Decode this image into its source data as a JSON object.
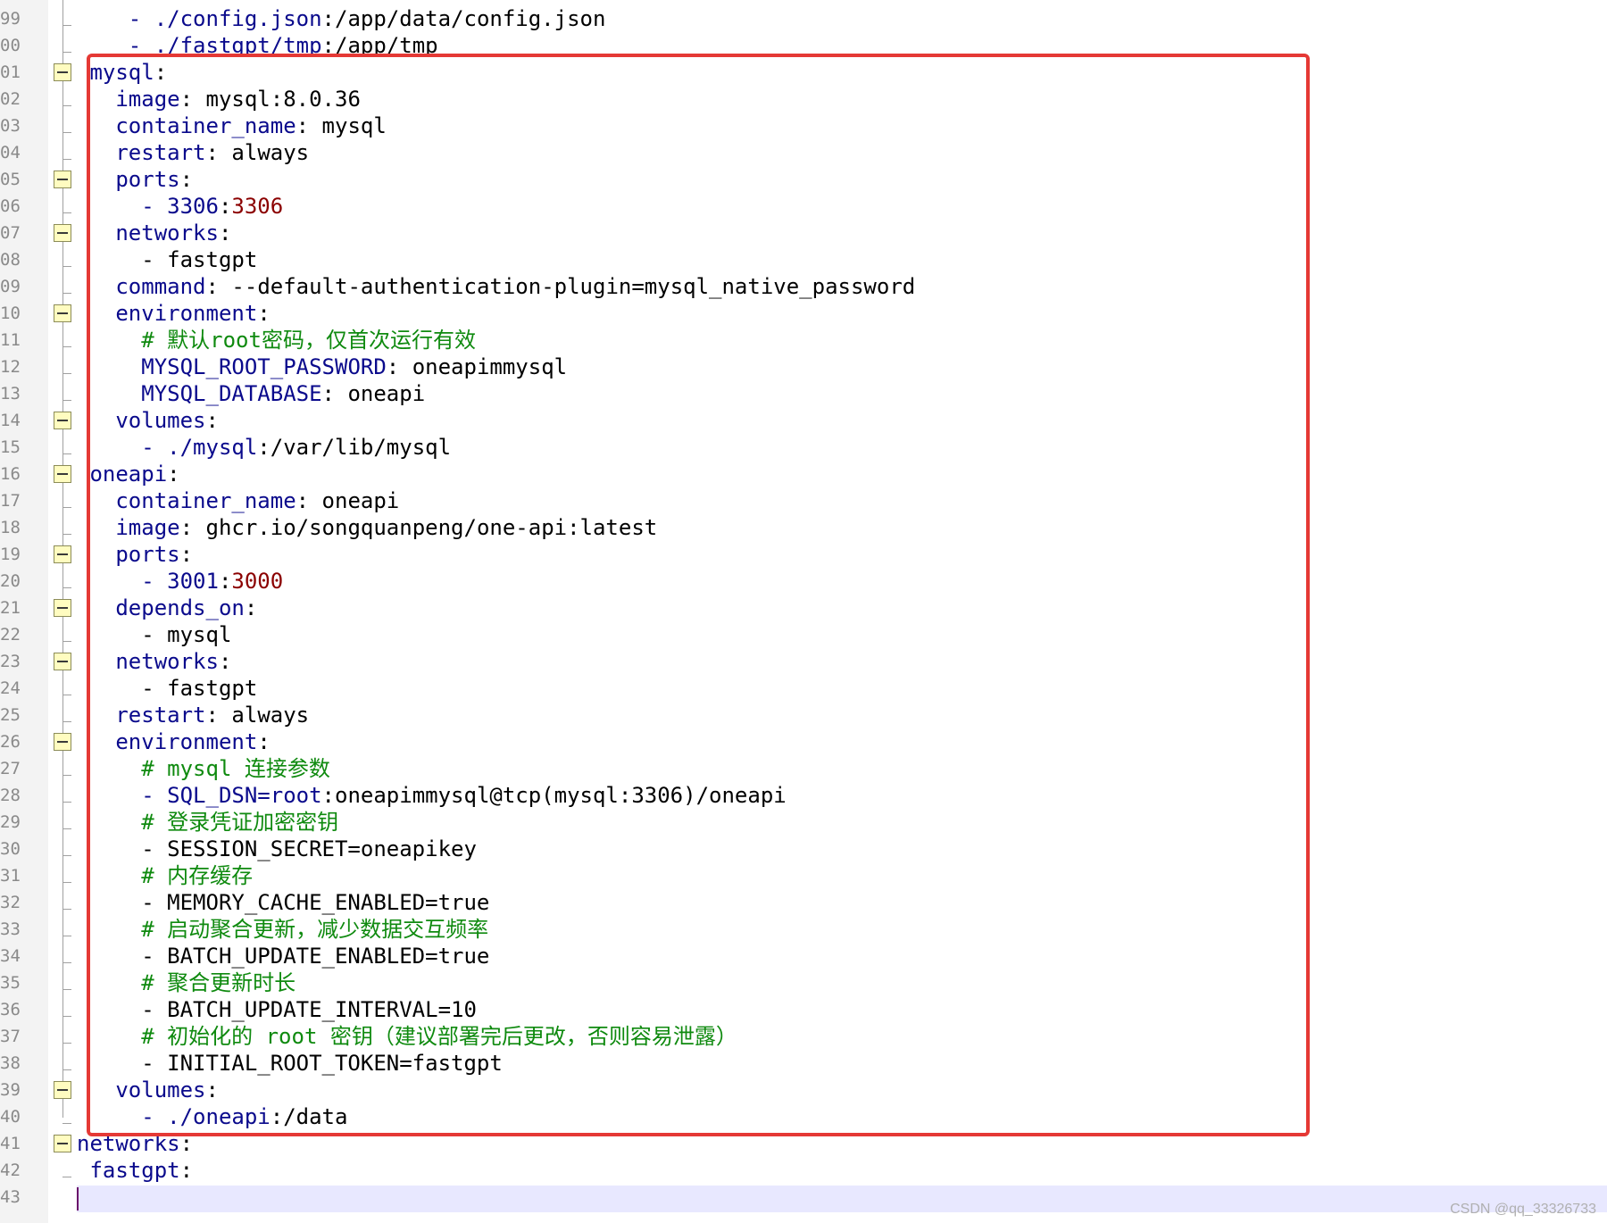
{
  "editor": {
    "lines": [
      {
        "num": "99",
        "fold": false,
        "segments": [
          {
            "t": "    ",
            "c": "v"
          },
          {
            "t": "- ./config.json",
            "c": "k"
          },
          {
            "t": ":/app/data/config.json",
            "c": "v"
          }
        ]
      },
      {
        "num": "00",
        "fold": false,
        "segments": [
          {
            "t": "    ",
            "c": "v"
          },
          {
            "t": "- ./fastgpt/tmp",
            "c": "k"
          },
          {
            "t": ":/app/tmp",
            "c": "v"
          }
        ]
      },
      {
        "num": "01",
        "fold": true,
        "segments": [
          {
            "t": " ",
            "c": "v"
          },
          {
            "t": "mysql",
            "c": "k"
          },
          {
            "t": ":",
            "c": "v"
          }
        ]
      },
      {
        "num": "02",
        "fold": false,
        "segments": [
          {
            "t": "   ",
            "c": "v"
          },
          {
            "t": "image",
            "c": "k"
          },
          {
            "t": ": mysql:8.0.36",
            "c": "v"
          }
        ]
      },
      {
        "num": "03",
        "fold": false,
        "segments": [
          {
            "t": "   ",
            "c": "v"
          },
          {
            "t": "container_name",
            "c": "k"
          },
          {
            "t": ": mysql",
            "c": "v"
          }
        ]
      },
      {
        "num": "04",
        "fold": false,
        "segments": [
          {
            "t": "   ",
            "c": "v"
          },
          {
            "t": "restart",
            "c": "k"
          },
          {
            "t": ": always",
            "c": "v"
          }
        ]
      },
      {
        "num": "05",
        "fold": true,
        "segments": [
          {
            "t": "   ",
            "c": "v"
          },
          {
            "t": "ports",
            "c": "k"
          },
          {
            "t": ":",
            "c": "v"
          }
        ]
      },
      {
        "num": "06",
        "fold": false,
        "segments": [
          {
            "t": "     ",
            "c": "v"
          },
          {
            "t": "- 3306",
            "c": "k"
          },
          {
            "t": ":",
            "c": "v"
          },
          {
            "t": "3306",
            "c": "n"
          }
        ]
      },
      {
        "num": "07",
        "fold": true,
        "segments": [
          {
            "t": "   ",
            "c": "v"
          },
          {
            "t": "networks",
            "c": "k"
          },
          {
            "t": ":",
            "c": "v"
          }
        ]
      },
      {
        "num": "08",
        "fold": false,
        "segments": [
          {
            "t": "     - fastgpt",
            "c": "v"
          }
        ]
      },
      {
        "num": "09",
        "fold": false,
        "segments": [
          {
            "t": "   ",
            "c": "v"
          },
          {
            "t": "command",
            "c": "k"
          },
          {
            "t": ": --default-authentication-plugin=mysql_native_password",
            "c": "v"
          }
        ]
      },
      {
        "num": "10",
        "fold": true,
        "segments": [
          {
            "t": "   ",
            "c": "v"
          },
          {
            "t": "environment",
            "c": "k"
          },
          {
            "t": ":",
            "c": "v"
          }
        ]
      },
      {
        "num": "11",
        "fold": false,
        "segments": [
          {
            "t": "     ",
            "c": "v"
          },
          {
            "t": "# 默认root密码，仅首次运行有效",
            "c": "c"
          }
        ]
      },
      {
        "num": "12",
        "fold": false,
        "segments": [
          {
            "t": "     ",
            "c": "v"
          },
          {
            "t": "MYSQL_ROOT_PASSWORD",
            "c": "k"
          },
          {
            "t": ": oneapimmysql",
            "c": "v"
          }
        ]
      },
      {
        "num": "13",
        "fold": false,
        "segments": [
          {
            "t": "     ",
            "c": "v"
          },
          {
            "t": "MYSQL_DATABASE",
            "c": "k"
          },
          {
            "t": ": oneapi",
            "c": "v"
          }
        ]
      },
      {
        "num": "14",
        "fold": true,
        "segments": [
          {
            "t": "   ",
            "c": "v"
          },
          {
            "t": "volumes",
            "c": "k"
          },
          {
            "t": ":",
            "c": "v"
          }
        ]
      },
      {
        "num": "15",
        "fold": false,
        "segments": [
          {
            "t": "     ",
            "c": "v"
          },
          {
            "t": "- ./mysql",
            "c": "k"
          },
          {
            "t": ":/var/lib/mysql",
            "c": "v"
          }
        ]
      },
      {
        "num": "16",
        "fold": true,
        "segments": [
          {
            "t": " ",
            "c": "v"
          },
          {
            "t": "oneapi",
            "c": "k"
          },
          {
            "t": ":",
            "c": "v"
          }
        ]
      },
      {
        "num": "17",
        "fold": false,
        "segments": [
          {
            "t": "   ",
            "c": "v"
          },
          {
            "t": "container_name",
            "c": "k"
          },
          {
            "t": ": oneapi",
            "c": "v"
          }
        ]
      },
      {
        "num": "18",
        "fold": false,
        "segments": [
          {
            "t": "   ",
            "c": "v"
          },
          {
            "t": "image",
            "c": "k"
          },
          {
            "t": ": ghcr.io/songquanpeng/one-api:latest",
            "c": "v"
          }
        ]
      },
      {
        "num": "19",
        "fold": true,
        "segments": [
          {
            "t": "   ",
            "c": "v"
          },
          {
            "t": "ports",
            "c": "k"
          },
          {
            "t": ":",
            "c": "v"
          }
        ]
      },
      {
        "num": "20",
        "fold": false,
        "segments": [
          {
            "t": "     ",
            "c": "v"
          },
          {
            "t": "- 3001",
            "c": "k"
          },
          {
            "t": ":",
            "c": "v"
          },
          {
            "t": "3000",
            "c": "n"
          }
        ]
      },
      {
        "num": "21",
        "fold": true,
        "segments": [
          {
            "t": "   ",
            "c": "v"
          },
          {
            "t": "depends_on",
            "c": "k"
          },
          {
            "t": ":",
            "c": "v"
          }
        ]
      },
      {
        "num": "22",
        "fold": false,
        "segments": [
          {
            "t": "     - mysql",
            "c": "v"
          }
        ]
      },
      {
        "num": "23",
        "fold": true,
        "segments": [
          {
            "t": "   ",
            "c": "v"
          },
          {
            "t": "networks",
            "c": "k"
          },
          {
            "t": ":",
            "c": "v"
          }
        ]
      },
      {
        "num": "24",
        "fold": false,
        "segments": [
          {
            "t": "     - fastgpt",
            "c": "v"
          }
        ]
      },
      {
        "num": "25",
        "fold": false,
        "segments": [
          {
            "t": "   ",
            "c": "v"
          },
          {
            "t": "restart",
            "c": "k"
          },
          {
            "t": ": always",
            "c": "v"
          }
        ]
      },
      {
        "num": "26",
        "fold": true,
        "segments": [
          {
            "t": "   ",
            "c": "v"
          },
          {
            "t": "environment",
            "c": "k"
          },
          {
            "t": ":",
            "c": "v"
          }
        ]
      },
      {
        "num": "27",
        "fold": false,
        "segments": [
          {
            "t": "     ",
            "c": "v"
          },
          {
            "t": "# mysql 连接参数",
            "c": "c"
          }
        ]
      },
      {
        "num": "28",
        "fold": false,
        "segments": [
          {
            "t": "     ",
            "c": "v"
          },
          {
            "t": "- SQL_DSN=root",
            "c": "k"
          },
          {
            "t": ":oneapimmysql@tcp(mysql:3306)/oneapi",
            "c": "v"
          }
        ]
      },
      {
        "num": "29",
        "fold": false,
        "segments": [
          {
            "t": "     ",
            "c": "v"
          },
          {
            "t": "# 登录凭证加密密钥",
            "c": "c"
          }
        ]
      },
      {
        "num": "30",
        "fold": false,
        "segments": [
          {
            "t": "     - SESSION_SECRET=oneapikey",
            "c": "v"
          }
        ]
      },
      {
        "num": "31",
        "fold": false,
        "segments": [
          {
            "t": "     ",
            "c": "v"
          },
          {
            "t": "# 内存缓存",
            "c": "c"
          }
        ]
      },
      {
        "num": "32",
        "fold": false,
        "segments": [
          {
            "t": "     - MEMORY_CACHE_ENABLED=true",
            "c": "v"
          }
        ]
      },
      {
        "num": "33",
        "fold": false,
        "segments": [
          {
            "t": "     ",
            "c": "v"
          },
          {
            "t": "# 启动聚合更新，减少数据交互频率",
            "c": "c"
          }
        ]
      },
      {
        "num": "34",
        "fold": false,
        "segments": [
          {
            "t": "     - BATCH_UPDATE_ENABLED=true",
            "c": "v"
          }
        ]
      },
      {
        "num": "35",
        "fold": false,
        "segments": [
          {
            "t": "     ",
            "c": "v"
          },
          {
            "t": "# 聚合更新时长",
            "c": "c"
          }
        ]
      },
      {
        "num": "36",
        "fold": false,
        "segments": [
          {
            "t": "     - BATCH_UPDATE_INTERVAL=10",
            "c": "v"
          }
        ]
      },
      {
        "num": "37",
        "fold": false,
        "segments": [
          {
            "t": "     ",
            "c": "v"
          },
          {
            "t": "# 初始化的 root 密钥（建议部署完后更改，否则容易泄露）",
            "c": "c"
          }
        ]
      },
      {
        "num": "38",
        "fold": false,
        "segments": [
          {
            "t": "     - INITIAL_ROOT_TOKEN=fastgpt",
            "c": "v"
          }
        ]
      },
      {
        "num": "39",
        "fold": true,
        "segments": [
          {
            "t": "   ",
            "c": "v"
          },
          {
            "t": "volumes",
            "c": "k"
          },
          {
            "t": ":",
            "c": "v"
          }
        ]
      },
      {
        "num": "40",
        "fold": false,
        "segments": [
          {
            "t": "     ",
            "c": "v"
          },
          {
            "t": "- ./oneapi",
            "c": "k"
          },
          {
            "t": ":/data",
            "c": "v"
          }
        ]
      },
      {
        "num": "41",
        "fold": true,
        "segments": [
          {
            "t": "networks",
            "c": "k"
          },
          {
            "t": ":",
            "c": "v"
          }
        ]
      },
      {
        "num": "42",
        "fold": false,
        "segments": [
          {
            "t": " ",
            "c": "v"
          },
          {
            "t": "fastgpt",
            "c": "k"
          },
          {
            "t": ":",
            "c": "v"
          }
        ]
      },
      {
        "num": "43",
        "fold": false,
        "segments": []
      }
    ]
  },
  "colors": {
    "keyword": "#0a0a8c",
    "number": "#8b0000",
    "comment": "#0f8a0f",
    "highlight_border": "#e53935"
  },
  "watermark": "CSDN @qq_33326733"
}
